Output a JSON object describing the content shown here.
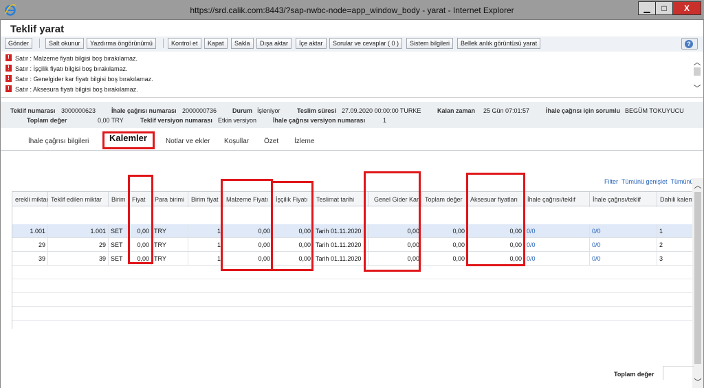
{
  "window": {
    "title": "https://srd.calik.com:8443/?sap-nwbc-node=app_window_body - yarat - Internet Explorer",
    "minimize": "▁",
    "maximize": "□",
    "close": "X"
  },
  "page": {
    "title": "Teklif yarat"
  },
  "toolbar": {
    "send": "Gönder",
    "read_only": "Salt okunur",
    "print_preview": "Yazdırma öngörünümü",
    "check": "Kontrol et",
    "close": "Kapat",
    "save": "Sakla",
    "export": "Dışa aktar",
    "import": "İçe aktar",
    "questions": "Sorular ve cevaplar ( 0 )",
    "system_info": "Sistem bilgileri",
    "memory_snapshot": "Bellek anlık görüntüsü yarat",
    "help": "?"
  },
  "messages": [
    "Satır : Malzeme fiyatı bilgisi boş bırakılamaz.",
    "Satır : İşçilik fiyatı bilgisi boş bırakılamaz.",
    "Satır : Genelgider kar fiyatı bilgisi boş bırakılamaz.",
    "Satır : Aksesura fiyatı bilgisi boş bırakılamaz."
  ],
  "header": {
    "quote_number_label": "Teklif numarası",
    "quote_number": "3000000623",
    "tender_number_label": "İhale çağrısı numarası",
    "tender_number": "2000000736",
    "status_label": "Durum",
    "status": "İşleniyor",
    "delivery_time_label": "Teslim süresi",
    "delivery_time": "27.09.2020 00:00:00 TURKE",
    "remaining_label": "Kalan zaman",
    "remaining": "25 Gün 07:01:57",
    "responsible_label": "İhale çağrısı için sorumlu",
    "responsible": "BEGÜM TOKUYUCU",
    "total_label": "Toplam değer",
    "total": "0,00 TRY",
    "quote_version_label": "Teklif versiyon numarası",
    "quote_version": "Etkin versiyon",
    "tender_version_label": "İhale çağrısı versiyon numarası",
    "tender_version": "1"
  },
  "tabs": {
    "tender_info": "İhale çağrısı bilgileri",
    "items": "Kalemler",
    "notes": "Notlar ve ekler",
    "conditions": "Koşullar",
    "summary": "Özet",
    "tracking": "İzleme"
  },
  "grid_actions": {
    "filter": "Filter",
    "expand_all": "Tümünü genişlet",
    "collapse_all": "Tümünü"
  },
  "columns": [
    "erekli miktar",
    "Teklif edilen miktar",
    "Birim",
    "Fiyat",
    "Para birimi",
    "Birim fiyat",
    "Malzeme Fiyatı",
    "İşçilik Fiyatı",
    "Teslimat tarihi",
    "Genel Gider Kar",
    "Toplam değer",
    "Aksesuar fiyatları",
    "İhale çağrısı/teklif",
    "İhale çağrısı/teklif",
    "Dahili kalem"
  ],
  "rows": [
    [
      "1.001",
      "1.001",
      "SET",
      "0,00",
      "TRY",
      "1",
      "0,00",
      "0,00",
      "Tarih 01.11.2020",
      "0,00",
      "0,00",
      "0,00",
      "0/0",
      "0/0",
      "1"
    ],
    [
      "29",
      "29",
      "SET",
      "0,00",
      "TRY",
      "1",
      "0,00",
      "0,00",
      "Tarih 01.11.2020",
      "0,00",
      "0,00",
      "0,00",
      "0/0",
      "0/0",
      "2"
    ],
    [
      "39",
      "39",
      "SET",
      "0,00",
      "TRY",
      "1",
      "0,00",
      "0,00",
      "Tarih 01.11.2020",
      "0,00",
      "0,00",
      "0,00",
      "0/0",
      "0/0",
      "3"
    ]
  ],
  "footer": {
    "total_label": "Toplam değer"
  },
  "colors": {
    "highlight": "#e0161a",
    "selected_row": "#dfe9f7",
    "link": "#2563b8"
  }
}
